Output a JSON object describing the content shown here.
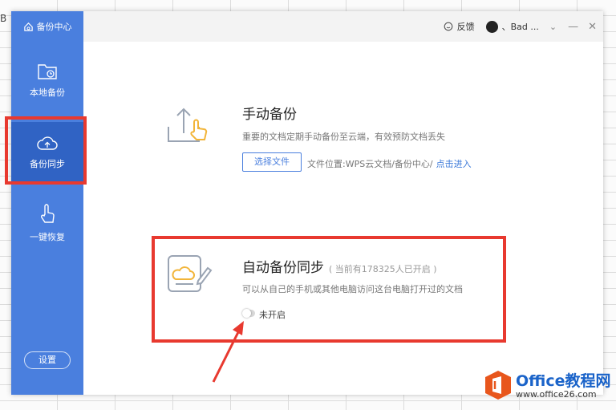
{
  "spreadsheet": {
    "cell_text": "B"
  },
  "sidebar": {
    "brand": "备份中心",
    "items": [
      {
        "label": "本地备份"
      },
      {
        "label": "备份同步"
      },
      {
        "label": "一键恢复"
      }
    ],
    "settings_label": "设置"
  },
  "topbar": {
    "feedback_label": "反馈",
    "username": "、Bad ..."
  },
  "manual_backup": {
    "title": "手动备份",
    "description": "重要的文档定期手动备份至云端，有效预防文档丢失",
    "choose_button": "选择文件",
    "path_text": "文件位置:WPS云文档/备份中心/",
    "enter_link": "点击进入"
  },
  "auto_sync": {
    "title": "自动备份同步",
    "count_note": "( 当前有178325人已开启 )",
    "description": "可以从自己的手机或其他电脑访问这台电脑打开过的文档",
    "toggle_state": "未开启"
  },
  "watermark": {
    "title": "Office教程网",
    "url": "www.office26.com"
  },
  "colors": {
    "sidebar": "#4a7fde",
    "sidebar_active": "#3063c4",
    "highlight": "#e8392f",
    "link": "#3a78d8"
  }
}
